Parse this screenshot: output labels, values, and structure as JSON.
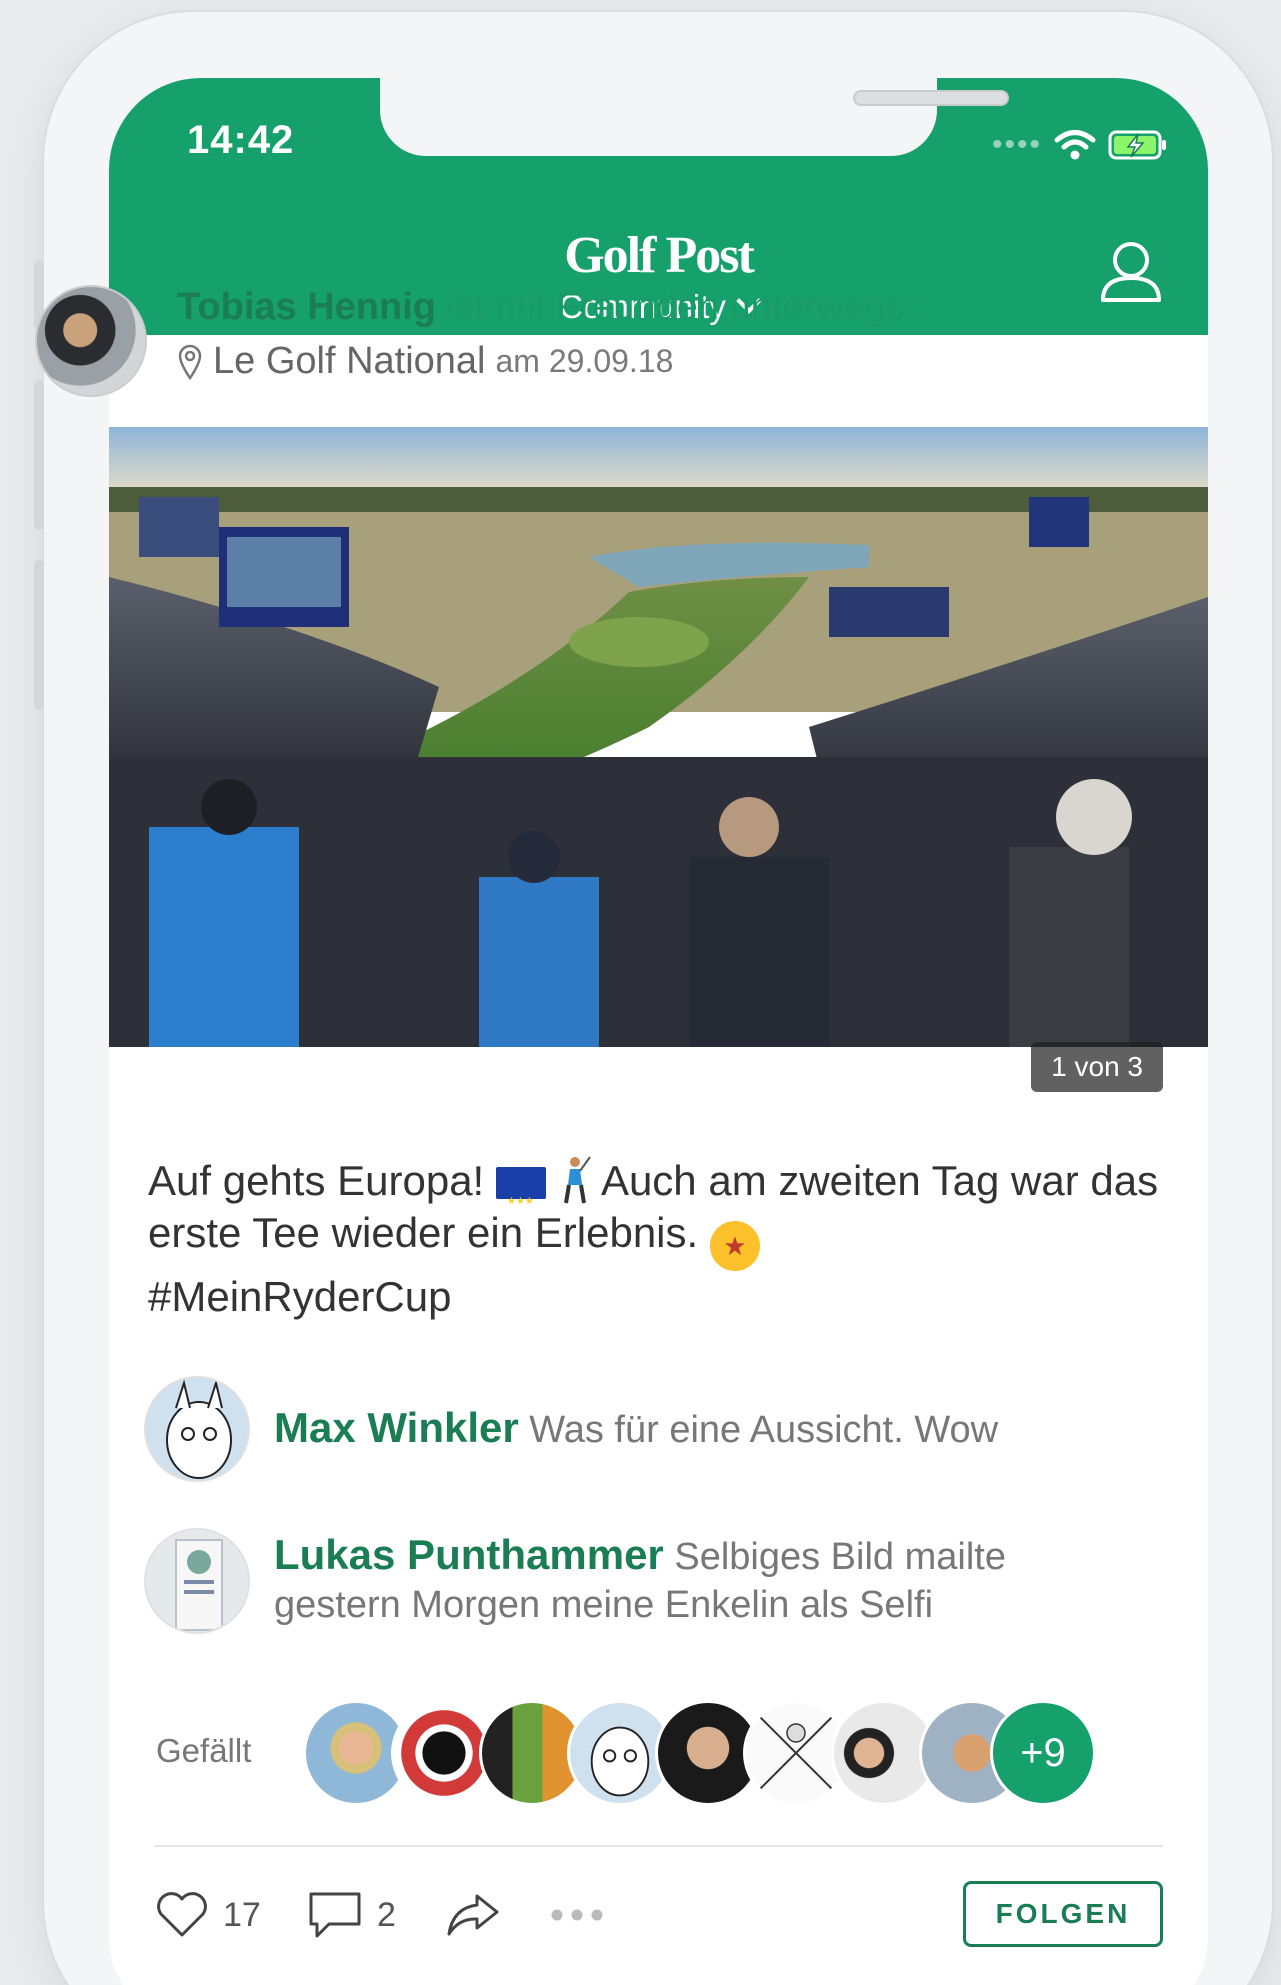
{
  "status_bar": {
    "time": "14:42",
    "signal": "••••",
    "wifi_icon": "wifi-icon",
    "battery_icon": "battery-charging-icon"
  },
  "header": {
    "logo": "Golf Post",
    "section": "Community",
    "accent_color": "#16a06c",
    "profile_icon": "user-icon"
  },
  "post": {
    "author": "Tobias Hennig",
    "activity": " ist mit Freunden unterwegs",
    "location": "Le Golf National",
    "date": "am 29.09.18",
    "photo_counter": "1 von 3",
    "caption_part1": "Auf gehts Europa!",
    "caption_part2": "Auch am zweiten Tag war das erste Tee wieder ein Erlebnis.",
    "caption_hashtag": "#MeinRyderCup"
  },
  "comments": [
    {
      "author": "Max Winkler",
      "text": "Was für eine Aussicht. Wow"
    },
    {
      "author": "Lukas Punthammer",
      "text": "Selbiges Bild mailte gestern Morgen meine Enkelin als Selfi"
    }
  ],
  "likes": {
    "label": "Gefällt",
    "more": "+9"
  },
  "actions": {
    "like_count": "17",
    "comment_count": "2",
    "follow_label": "FOLGEN"
  }
}
